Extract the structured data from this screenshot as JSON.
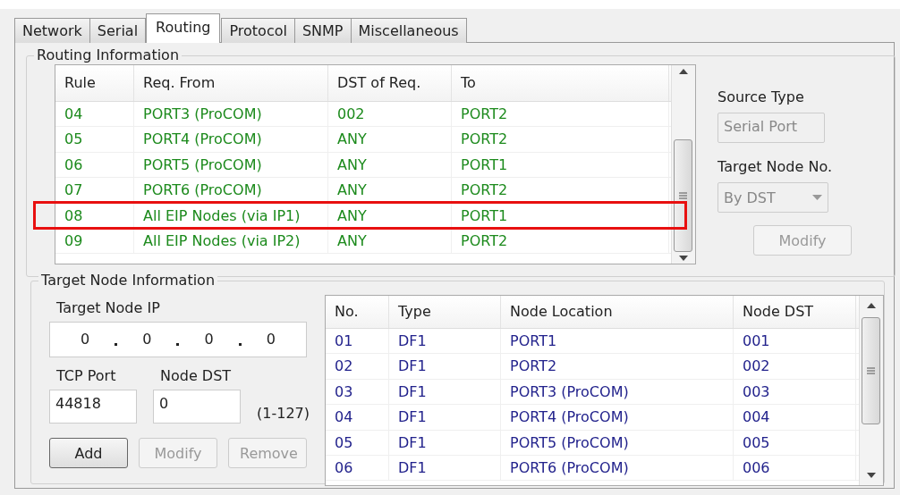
{
  "tabs": [
    {
      "label": "Network",
      "selected": false
    },
    {
      "label": "Serial",
      "selected": false
    },
    {
      "label": "Routing",
      "selected": true
    },
    {
      "label": "Protocol",
      "selected": false
    },
    {
      "label": "SNMP",
      "selected": false
    },
    {
      "label": "Miscellaneous",
      "selected": false
    }
  ],
  "routing_information": {
    "title": "Routing Information",
    "table": {
      "columns": [
        "Rule",
        "Req. From",
        "DST of Req.",
        "To"
      ],
      "rows": [
        {
          "cells": [
            "04",
            "PORT3 (ProCOM)",
            "002",
            "PORT2"
          ],
          "highlighted": false
        },
        {
          "cells": [
            "05",
            "PORT4 (ProCOM)",
            "ANY",
            "PORT2"
          ],
          "highlighted": false
        },
        {
          "cells": [
            "06",
            "PORT5 (ProCOM)",
            "ANY",
            "PORT1"
          ],
          "highlighted": false
        },
        {
          "cells": [
            "07",
            "PORT6 (ProCOM)",
            "ANY",
            "PORT2"
          ],
          "highlighted": false
        },
        {
          "cells": [
            "08",
            "All EIP Nodes (via IP1)",
            "ANY",
            "PORT1"
          ],
          "highlighted": true
        },
        {
          "cells": [
            "09",
            "All EIP Nodes (via IP2)",
            "ANY",
            "PORT2"
          ],
          "highlighted": false
        }
      ]
    },
    "source_type": {
      "label": "Source Type",
      "value": "Serial Port",
      "disabled": true
    },
    "target_node_no": {
      "label": "Target Node No.",
      "value": "By DST",
      "disabled": true
    },
    "modify_button": {
      "label": "Modify",
      "disabled": true
    }
  },
  "target_node_information": {
    "title": "Target Node Information",
    "target_node_ip": {
      "label": "Target Node IP",
      "octets": [
        "0",
        "0",
        "0",
        "0"
      ]
    },
    "tcp_port": {
      "label": "TCP Port",
      "value": "44818"
    },
    "node_dst": {
      "label": "Node DST",
      "value": "0",
      "range": "(1-127)"
    },
    "buttons": [
      {
        "label": "Add",
        "disabled": false
      },
      {
        "label": "Modify",
        "disabled": true
      },
      {
        "label": "Remove",
        "disabled": true
      }
    ],
    "table": {
      "columns": [
        "No.",
        "Type",
        "Node Location",
        "Node DST"
      ],
      "rows": [
        [
          "01",
          "DF1",
          "PORT1",
          "001"
        ],
        [
          "02",
          "DF1",
          "PORT2",
          "002"
        ],
        [
          "03",
          "DF1",
          "PORT3 (ProCOM)",
          "003"
        ],
        [
          "04",
          "DF1",
          "PORT4 (ProCOM)",
          "004"
        ],
        [
          "05",
          "DF1",
          "PORT5 (ProCOM)",
          "005"
        ],
        [
          "06",
          "DF1",
          "PORT6 (ProCOM)",
          "006"
        ]
      ]
    }
  }
}
